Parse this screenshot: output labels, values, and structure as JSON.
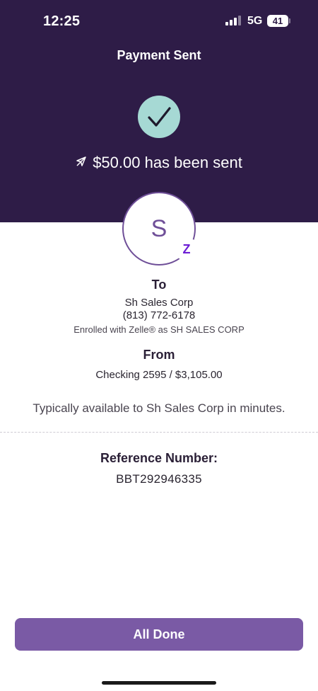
{
  "status_bar": {
    "time": "12:25",
    "network": "5G",
    "battery": "41"
  },
  "header": {
    "title": "Payment Sent",
    "sent_message": "$50.00 has been sent",
    "background_color": "#2e1c47",
    "check_color": "#a6d9d4"
  },
  "recipient": {
    "avatar_initial": "S",
    "badge_icon": "zelle-icon",
    "to_label": "To",
    "name": "Sh Sales Corp",
    "phone": "(813) 772-6178",
    "enrolled": "Enrolled with Zelle® as SH SALES CORP"
  },
  "from": {
    "label": "From",
    "account": "Checking 2595 / $3,105.00"
  },
  "availability": "Typically available to Sh Sales Corp in minutes.",
  "reference": {
    "label": "Reference Number:",
    "number": "BBT292946335"
  },
  "actions": {
    "done_label": "All Done",
    "button_color": "#7a5aa5"
  }
}
